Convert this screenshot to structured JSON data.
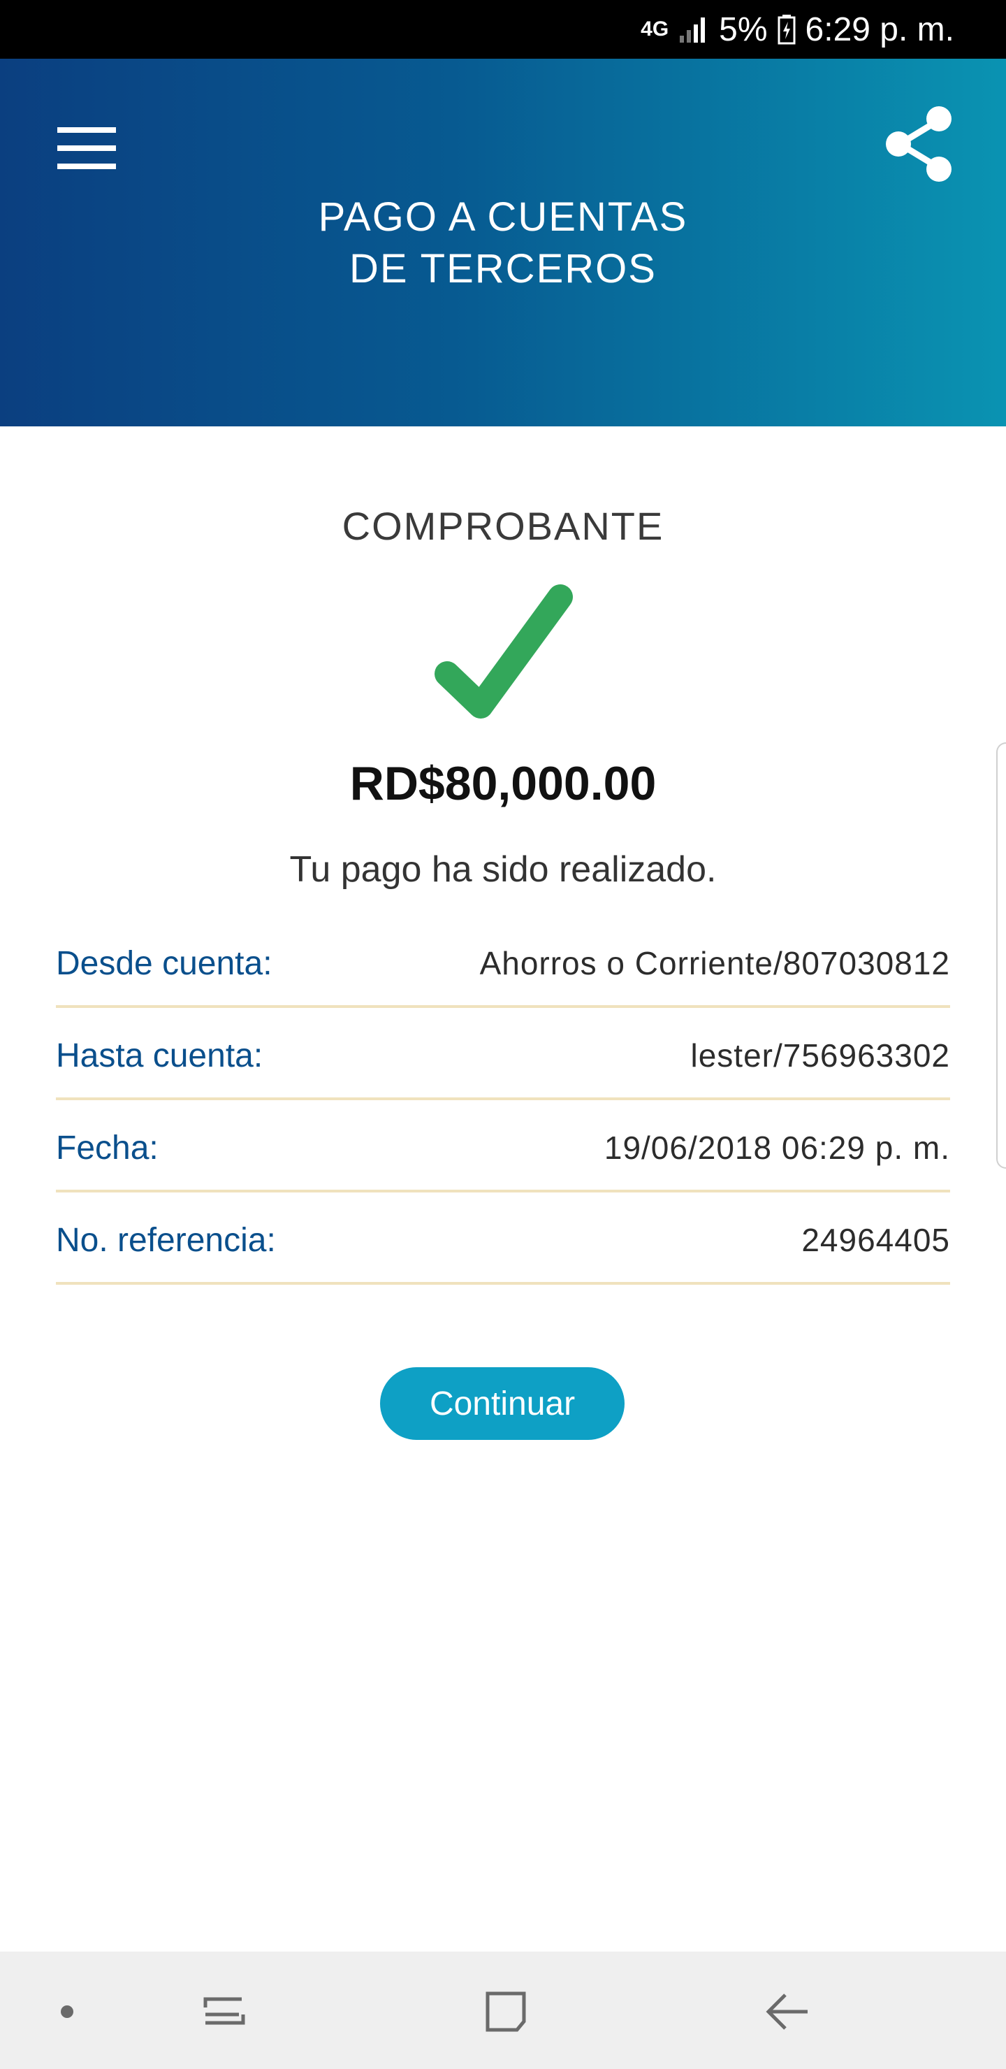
{
  "status_bar": {
    "network": "4G",
    "battery": "5%",
    "time": "6:29 p. m."
  },
  "header": {
    "title_line1": "PAGO A CUENTAS",
    "title_line2": "DE TERCEROS",
    "menu_icon": "hamburger-menu-icon",
    "share_icon": "share-icon"
  },
  "receipt": {
    "title": "COMPROBANTE",
    "status_icon": "checkmark-icon",
    "status_color": "#33a75a",
    "amount": "RD$80,000.00",
    "message": "Tu pago ha sido realizado."
  },
  "details": [
    {
      "label": "Desde cuenta:",
      "value": "Ahorros o Corriente/807030812"
    },
    {
      "label": "Hasta cuenta:",
      "value": "lester/756963302"
    },
    {
      "label": "Fecha:",
      "value": "19/06/2018 06:29 p. m."
    },
    {
      "label": "No. referencia:",
      "value": "24964405"
    }
  ],
  "actions": {
    "continue_label": "Continuar"
  },
  "colors": {
    "header_start": "#0b3f80",
    "header_end": "#0a93b2",
    "label": "#0a4f8c",
    "button": "#0ea0c5",
    "divider": "#f0e2bd"
  },
  "nav_bar": [
    "dot-icon",
    "recent-apps-icon",
    "home-icon",
    "back-icon"
  ]
}
